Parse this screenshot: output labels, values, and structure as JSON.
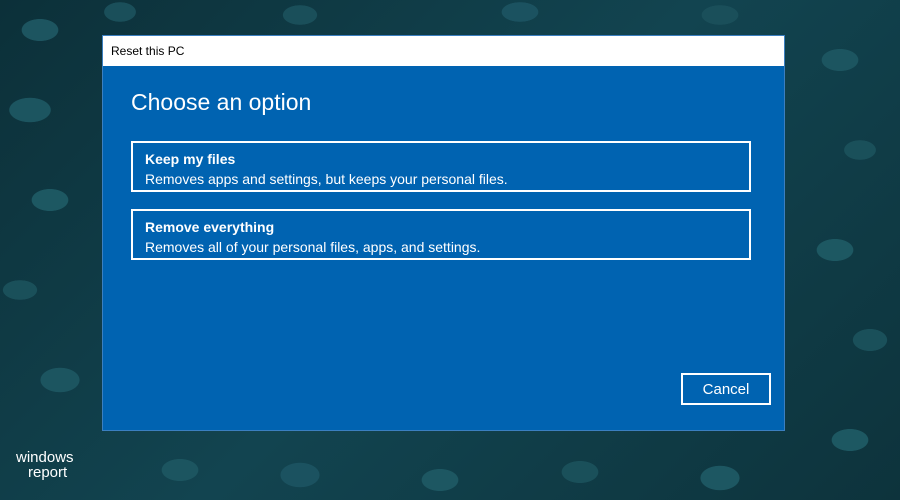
{
  "window": {
    "title": "Reset this PC"
  },
  "dialog": {
    "heading": "Choose an option",
    "options": [
      {
        "title": "Keep my files",
        "description": "Removes apps and settings, but keeps your personal files."
      },
      {
        "title": "Remove everything",
        "description": "Removes all of your personal files, apps, and settings."
      }
    ],
    "cancel_label": "Cancel"
  },
  "watermark": {
    "line1": "windows",
    "line2": "report"
  },
  "colors": {
    "dialog_background": "#0063b1",
    "titlebar_background": "#ffffff",
    "desktop_background": "#0f3b45",
    "text": "#ffffff"
  }
}
